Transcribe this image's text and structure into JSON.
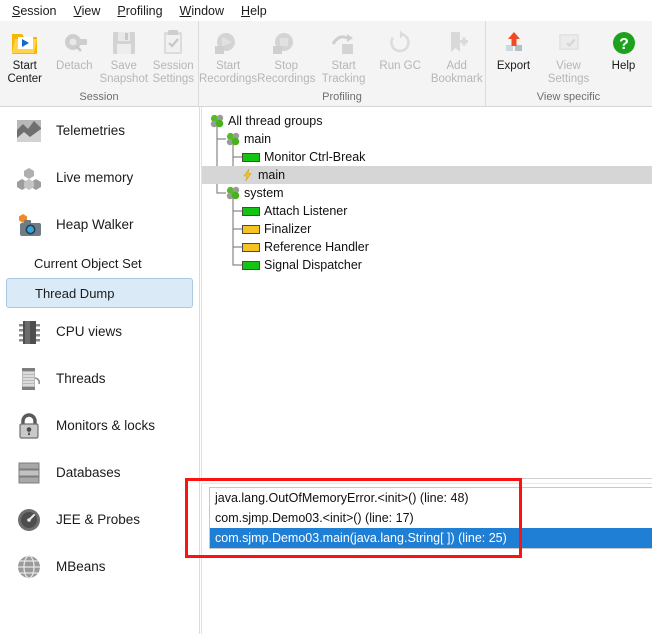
{
  "menubar": {
    "items": [
      {
        "label": "Session",
        "mnemonic": "S"
      },
      {
        "label": "View",
        "mnemonic": "V"
      },
      {
        "label": "Profiling",
        "mnemonic": "P"
      },
      {
        "label": "Window",
        "mnemonic": "W"
      },
      {
        "label": "Help",
        "mnemonic": "H"
      }
    ]
  },
  "ribbon": {
    "groups": [
      {
        "title": "Session",
        "buttons": [
          {
            "label": "Start\nCenter",
            "icon": "start-center-icon",
            "enabled": true
          },
          {
            "label": "Detach",
            "icon": "detach-icon",
            "enabled": false
          },
          {
            "label": "Save\nSnapshot",
            "icon": "save-snapshot-icon",
            "enabled": false
          },
          {
            "label": "Session\nSettings",
            "icon": "session-settings-icon",
            "enabled": false
          }
        ]
      },
      {
        "title": "Profiling",
        "buttons": [
          {
            "label": "Start\nRecordings",
            "icon": "start-recordings-icon",
            "enabled": false
          },
          {
            "label": "Stop\nRecordings",
            "icon": "stop-recordings-icon",
            "enabled": false
          },
          {
            "label": "Start\nTracking",
            "icon": "start-tracking-icon",
            "enabled": false
          },
          {
            "label": "Run GC",
            "icon": "run-gc-icon",
            "enabled": false
          },
          {
            "label": "Add\nBookmark",
            "icon": "add-bookmark-icon",
            "enabled": false
          }
        ]
      },
      {
        "title": "View specific",
        "buttons": [
          {
            "label": "Export",
            "icon": "export-icon",
            "enabled": true
          },
          {
            "label": "View\nSettings",
            "icon": "view-settings-icon",
            "enabled": false
          },
          {
            "label": "Help",
            "icon": "help-icon",
            "enabled": true
          }
        ]
      }
    ]
  },
  "sidebar": {
    "items": [
      {
        "label": "Telemetries",
        "icon": "telemetries-icon",
        "type": "main"
      },
      {
        "label": "Live memory",
        "icon": "live-memory-icon",
        "type": "main"
      },
      {
        "label": "Heap Walker",
        "icon": "heap-walker-icon",
        "type": "main"
      },
      {
        "label": "Current Object Set",
        "icon": "",
        "type": "sub",
        "selected": false
      },
      {
        "label": "Thread Dump",
        "icon": "",
        "type": "sub",
        "selected": true
      },
      {
        "label": "CPU views",
        "icon": "cpu-views-icon",
        "type": "main"
      },
      {
        "label": "Threads",
        "icon": "threads-icon",
        "type": "main"
      },
      {
        "label": "Monitors & locks",
        "icon": "monitors-locks-icon",
        "type": "main"
      },
      {
        "label": "Databases",
        "icon": "databases-icon",
        "type": "main"
      },
      {
        "label": "JEE & Probes",
        "icon": "jee-probes-icon",
        "type": "main"
      },
      {
        "label": "MBeans",
        "icon": "mbeans-icon",
        "type": "main"
      }
    ]
  },
  "thread_tree": {
    "nodes": [
      {
        "label": "All thread groups",
        "depth": 0,
        "icon": "thread-group-icon",
        "status": "",
        "selected": false
      },
      {
        "label": "main",
        "depth": 1,
        "icon": "thread-group-icon",
        "status": "",
        "selected": false
      },
      {
        "label": "Monitor Ctrl-Break",
        "depth": 2,
        "icon": "thread-status-bar",
        "status": "runnable",
        "selected": false
      },
      {
        "label": "main",
        "depth": 2,
        "icon": "thread-blocked-icon",
        "status": "blocked",
        "selected": true
      },
      {
        "label": "system",
        "depth": 1,
        "icon": "thread-group-icon",
        "status": "",
        "selected": false
      },
      {
        "label": "Attach Listener",
        "depth": 2,
        "icon": "thread-status-bar",
        "status": "runnable",
        "selected": false
      },
      {
        "label": "Finalizer",
        "depth": 2,
        "icon": "thread-status-bar",
        "status": "waiting",
        "selected": false
      },
      {
        "label": "Reference Handler",
        "depth": 2,
        "icon": "thread-status-bar",
        "status": "waiting",
        "selected": false
      },
      {
        "label": "Signal Dispatcher",
        "depth": 2,
        "icon": "thread-status-bar",
        "status": "runnable",
        "selected": false
      }
    ]
  },
  "stack_trace": {
    "frames": [
      {
        "text": "java.lang.OutOfMemoryError.<init>() (line: 48)",
        "selected": false
      },
      {
        "text": "com.sjmp.Demo03.<init>() (line: 17)",
        "selected": false
      },
      {
        "text": "com.sjmp.Demo03.main(java.lang.String[ ]) (line: 25)",
        "selected": true
      }
    ]
  },
  "colors": {
    "accent_selection": "#1e7fd4",
    "annotation": "#fe1111",
    "status_runnable": "#13c413",
    "status_waiting": "#f5c424",
    "sidebar_selected": "#dbeaf7"
  }
}
